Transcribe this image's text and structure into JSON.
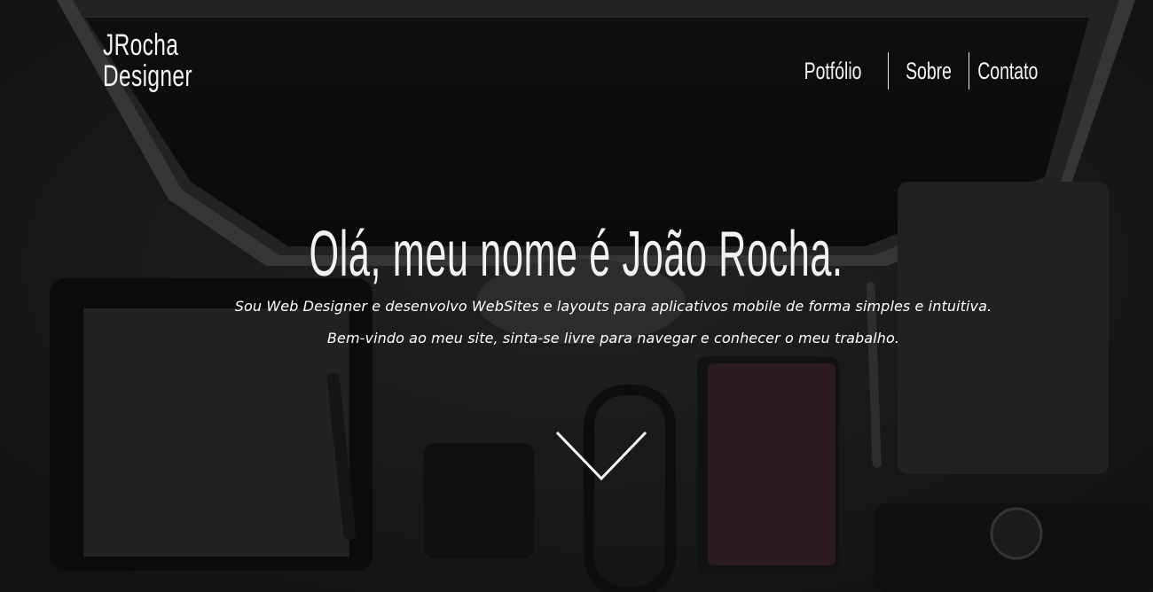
{
  "brand": {
    "line1": "JRocha",
    "line2": "Designer"
  },
  "nav": {
    "items": [
      "Potfólio",
      "Sobre",
      "Contato"
    ]
  },
  "hero": {
    "title": "Olá, meu nome é João Rocha.",
    "subtitle1": "Sou Web Designer e desenvolvo WebSites e layouts para aplicativos mobile de forma simples e intuitiva.",
    "subtitle2": "Bem-vindo ao meu site, sinta-se livre para navegar e conhecer o meu trabalho."
  },
  "icons": {
    "scroll": "chevron-down-icon"
  },
  "colors": {
    "text": "#ffffff",
    "background": "#1d1d1f"
  }
}
